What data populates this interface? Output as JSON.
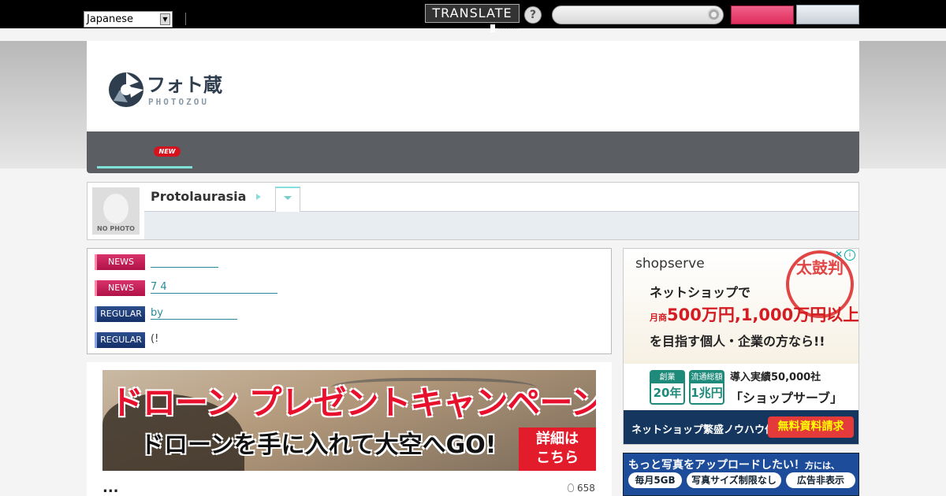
{
  "topbar": {
    "language": "Japanese",
    "translate_label": "TRANSLATE",
    "help_glyph": "?"
  },
  "header": {
    "tagline": "",
    "logo_text_jp": "フォト蔵",
    "logo_text_en": "PHOTOZOU"
  },
  "nav": {
    "new_badge": "NEW"
  },
  "profile": {
    "username": "Protolaurasia",
    "avatar_caption": "NO PHOTO"
  },
  "news": [
    {
      "tag": "NEWS",
      "kind": "news",
      "text": "",
      "link": true
    },
    {
      "tag": "NEWS",
      "kind": "news",
      "text": "7 4",
      "link": true
    },
    {
      "tag": "REGULAR",
      "kind": "regular",
      "text": "by",
      "link": true
    },
    {
      "tag": "REGULAR",
      "kind": "regular",
      "text": "(!",
      "link": false
    }
  ],
  "banner": {
    "headline": "ドローン プレゼントキャンペーン！",
    "subline": "ドローンを手に入れて大空へGO!",
    "detail_line1": "詳細は",
    "detail_line2": "こちら"
  },
  "photo": {
    "title": "...",
    "views": "658"
  },
  "ad_shopserve": {
    "logo_prefix": "",
    "logo": "shopserve",
    "stamp": "太鼓判",
    "line1": "ネットショップで",
    "line2_prefix": "月商",
    "line2": "500万円,1,000万円以上",
    "line3": "を目指す個人・企業の方なら!!",
    "stat1_head": "創業",
    "stat1_value": "20年",
    "stat2_head": "流通総額",
    "stat2_value": "1兆円",
    "achievement": "導入実績50,000社",
    "brand": "「ショップサーブ」",
    "bottom_text": "ネットショップ繁盛ノウハウ付",
    "cta": "無料資料請求"
  },
  "ad_upload": {
    "headline": "もっと写真をアップロードしたい！",
    "headline_suffix": "方には、",
    "pill1": "毎月5GB",
    "pill2": "写真サイズ制限なし",
    "pill3": "広告非表示"
  },
  "colors": {
    "topbar": "#000000",
    "nav": "#5b5f63",
    "accent_teal": "#7fe0d8",
    "news_tag": "#c01a50",
    "regular_tag": "#1e3d78"
  }
}
